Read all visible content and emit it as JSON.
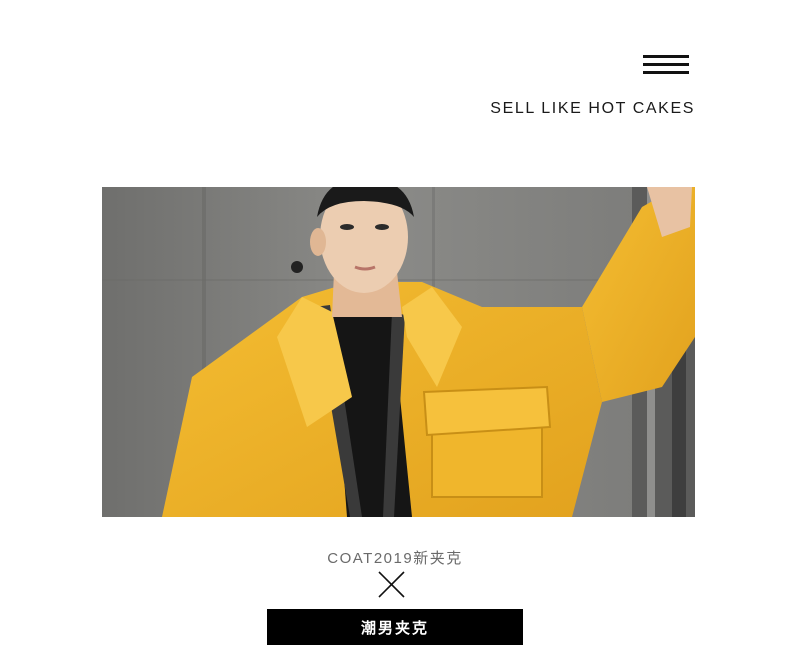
{
  "header": {
    "menu_icon": "hamburger-menu-icon",
    "headline": "SELL LIKE HOT CAKES"
  },
  "hero": {
    "image": "photo of young man in yellow jacket"
  },
  "caption": {
    "subtitle": "COAT2019新夹克",
    "divider_icon": "cross-x-icon",
    "tag_label": "潮男夹克"
  },
  "colors": {
    "accent_yellow": "#F1B52A",
    "tag_background": "#000000",
    "tag_text": "#FFFFFF",
    "subtitle_text": "#6A6A6A"
  }
}
